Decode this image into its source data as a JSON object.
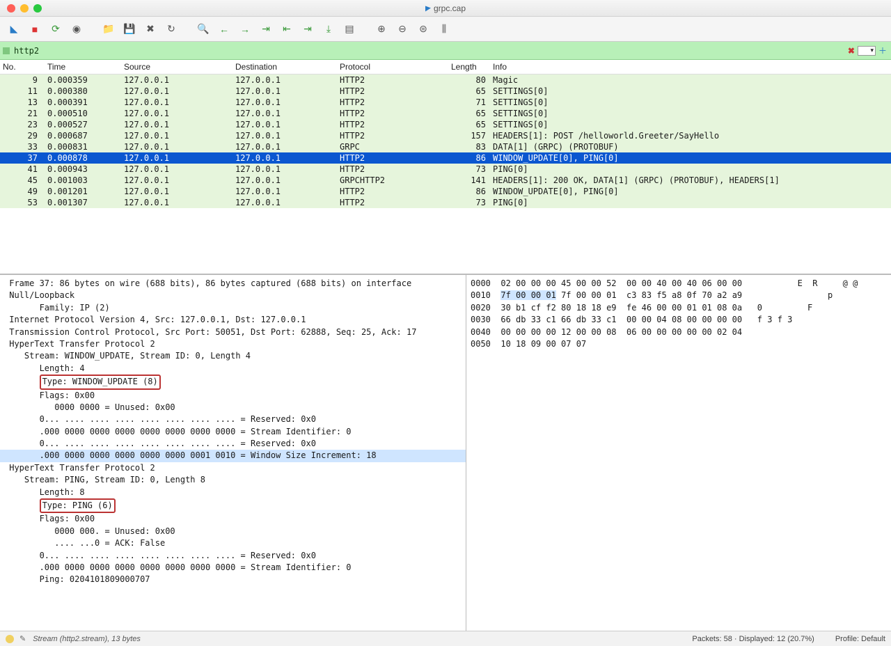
{
  "window": {
    "title": "grpc.cap"
  },
  "filter": {
    "value": "http2"
  },
  "columns": [
    "No.",
    "Time",
    "Source",
    "Destination",
    "Protocol",
    "Length",
    "Info"
  ],
  "packets": [
    {
      "no": 9,
      "time": "0.000359",
      "src": "127.0.0.1",
      "dst": "127.0.0.1",
      "proto": "HTTP2",
      "len": 80,
      "info": "Magic",
      "sel": false
    },
    {
      "no": 11,
      "time": "0.000380",
      "src": "127.0.0.1",
      "dst": "127.0.0.1",
      "proto": "HTTP2",
      "len": 65,
      "info": "SETTINGS[0]",
      "sel": false
    },
    {
      "no": 13,
      "time": "0.000391",
      "src": "127.0.0.1",
      "dst": "127.0.0.1",
      "proto": "HTTP2",
      "len": 71,
      "info": "SETTINGS[0]",
      "sel": false
    },
    {
      "no": 21,
      "time": "0.000510",
      "src": "127.0.0.1",
      "dst": "127.0.0.1",
      "proto": "HTTP2",
      "len": 65,
      "info": "SETTINGS[0]",
      "sel": false
    },
    {
      "no": 23,
      "time": "0.000527",
      "src": "127.0.0.1",
      "dst": "127.0.0.1",
      "proto": "HTTP2",
      "len": 65,
      "info": "SETTINGS[0]",
      "sel": false
    },
    {
      "no": 29,
      "time": "0.000687",
      "src": "127.0.0.1",
      "dst": "127.0.0.1",
      "proto": "HTTP2",
      "len": 157,
      "info": "HEADERS[1]: POST /helloworld.Greeter/SayHello",
      "sel": false
    },
    {
      "no": 33,
      "time": "0.000831",
      "src": "127.0.0.1",
      "dst": "127.0.0.1",
      "proto": "GRPC",
      "len": 83,
      "info": "DATA[1] (GRPC) (PROTOBUF)",
      "sel": false
    },
    {
      "no": 37,
      "time": "0.000878",
      "src": "127.0.0.1",
      "dst": "127.0.0.1",
      "proto": "HTTP2",
      "len": 86,
      "info": "WINDOW_UPDATE[0], PING[0]",
      "sel": true
    },
    {
      "no": 41,
      "time": "0.000943",
      "src": "127.0.0.1",
      "dst": "127.0.0.1",
      "proto": "HTTP2",
      "len": 73,
      "info": "PING[0]",
      "sel": false
    },
    {
      "no": 45,
      "time": "0.001003",
      "src": "127.0.0.1",
      "dst": "127.0.0.1",
      "proto": "GRPCHTTP2",
      "len": 141,
      "info": "HEADERS[1]: 200 OK, DATA[1] (GRPC) (PROTOBUF), HEADERS[1]",
      "sel": false
    },
    {
      "no": 49,
      "time": "0.001201",
      "src": "127.0.0.1",
      "dst": "127.0.0.1",
      "proto": "HTTP2",
      "len": 86,
      "info": "WINDOW_UPDATE[0], PING[0]",
      "sel": false
    },
    {
      "no": 53,
      "time": "0.001307",
      "src": "127.0.0.1",
      "dst": "127.0.0.1",
      "proto": "HTTP2",
      "len": 73,
      "info": "PING[0]",
      "sel": false
    }
  ],
  "tree": [
    {
      "indent": 0,
      "txt": "Frame 37: 86 bytes on wire (688 bits), 86 bytes captured (688 bits) on interface"
    },
    {
      "indent": 0,
      "txt": "Null/Loopback"
    },
    {
      "indent": 2,
      "txt": "Family: IP (2)"
    },
    {
      "indent": 0,
      "txt": "Internet Protocol Version 4, Src: 127.0.0.1, Dst: 127.0.0.1"
    },
    {
      "indent": 0,
      "txt": "Transmission Control Protocol, Src Port: 50051, Dst Port: 62888, Seq: 25, Ack: 17"
    },
    {
      "indent": 0,
      "txt": "HyperText Transfer Protocol 2"
    },
    {
      "indent": 1,
      "txt": "Stream: WINDOW_UPDATE, Stream ID: 0, Length 4"
    },
    {
      "indent": 2,
      "txt": "Length: 4"
    },
    {
      "indent": 2,
      "txt": "Type: WINDOW_UPDATE (8)",
      "boxed": true
    },
    {
      "indent": 2,
      "txt": "Flags: 0x00"
    },
    {
      "indent": 3,
      "txt": "0000 0000 = Unused: 0x00"
    },
    {
      "indent": 2,
      "txt": "0... .... .... .... .... .... .... .... = Reserved: 0x0"
    },
    {
      "indent": 2,
      "txt": ".000 0000 0000 0000 0000 0000 0000 0000 = Stream Identifier: 0"
    },
    {
      "indent": 2,
      "txt": "0... .... .... .... .... .... .... .... = Reserved: 0x0"
    },
    {
      "indent": 2,
      "txt": ".000 0000 0000 0000 0000 0000 0001 0010 = Window Size Increment: 18",
      "sel": true
    },
    {
      "indent": 0,
      "txt": "HyperText Transfer Protocol 2"
    },
    {
      "indent": 1,
      "txt": "Stream: PING, Stream ID: 0, Length 8"
    },
    {
      "indent": 2,
      "txt": "Length: 8"
    },
    {
      "indent": 2,
      "txt": "Type: PING (6)",
      "boxed": true
    },
    {
      "indent": 2,
      "txt": "Flags: 0x00"
    },
    {
      "indent": 3,
      "txt": "0000 000. = Unused: 0x00"
    },
    {
      "indent": 3,
      "txt": ".... ...0 = ACK: False"
    },
    {
      "indent": 2,
      "txt": "0... .... .... .... .... .... .... .... = Reserved: 0x0"
    },
    {
      "indent": 2,
      "txt": ".000 0000 0000 0000 0000 0000 0000 0000 = Stream Identifier: 0"
    },
    {
      "indent": 2,
      "txt": "Ping: 0204101809000707"
    }
  ],
  "hex": [
    {
      "off": "0000",
      "b": "02 00 00 00 45 00 00 52  00 00 40 00 40 06 00 00",
      "a": "        E  R     @ @"
    },
    {
      "off": "0010",
      "b_hi": "7f 00 00 01",
      "b_rest": " 7f 00 00 01  c3 83 f5 a8 0f 70 a2 a9",
      "a": "              p"
    },
    {
      "off": "0020",
      "b": "30 b1 cf f2 80 18 18 e9  fe 46 00 00 01 01 08 0a",
      "a": "0         F"
    },
    {
      "off": "0030",
      "b": "66 db 33 c1 66 db 33 c1  00 00 04 08 00 00 00 00",
      "a": "f 3 f 3"
    },
    {
      "off": "0040",
      "b": "00 00 00 00 12 00 00 08  06 00 00 00 00 00 02 04",
      "a": ""
    },
    {
      "off": "0050",
      "b": "10 18 09 00 07 07",
      "a": ""
    }
  ],
  "status": {
    "left": "Stream (http2.stream), 13 bytes",
    "mid": "Packets: 58 · Displayed: 12 (20.7%)",
    "right": "Profile: Default"
  },
  "toolbar_icons": [
    "shark-fin-icon",
    "stop-icon",
    "restart-icon",
    "options-icon",
    "open-icon",
    "save-icon",
    "close-icon",
    "reload-icon",
    "find-icon",
    "prev-icon",
    "next-icon",
    "jump-icon",
    "first-icon",
    "last-icon",
    "autoscroll-icon",
    "colorize-icon",
    "zoom-in-icon",
    "zoom-out-icon",
    "zoom-reset-icon",
    "resize-columns-icon"
  ]
}
